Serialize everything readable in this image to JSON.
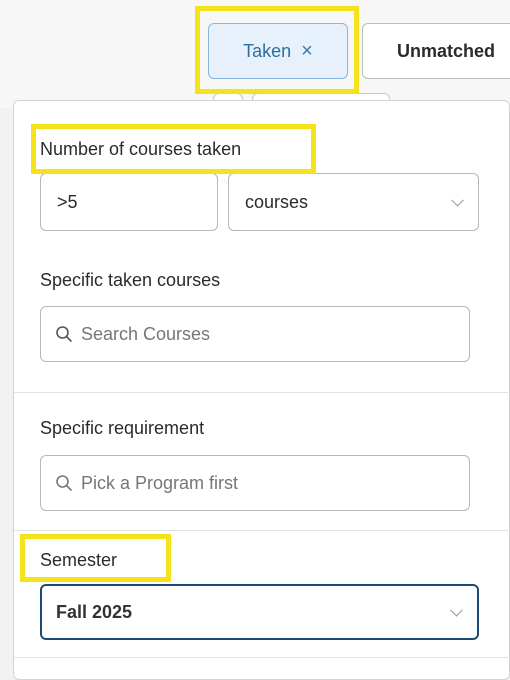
{
  "filters": {
    "taken_chip": {
      "label": "Taken",
      "remove_icon": "×"
    },
    "unmatched_chip": {
      "label": "Unmatched"
    }
  },
  "panel": {
    "number_of_courses": {
      "label": "Number of courses taken",
      "value": ">5",
      "unit": "courses"
    },
    "specific_courses": {
      "label": "Specific taken courses",
      "placeholder": "Search Courses"
    },
    "specific_requirement": {
      "label": "Specific requirement",
      "placeholder": "Pick a Program first"
    },
    "semester": {
      "label": "Semester",
      "value": "Fall 2025"
    }
  },
  "colors": {
    "highlight": "#f6e21b",
    "accent": "#2e6e9e",
    "focus_border": "#1e4a72"
  },
  "icons": {
    "remove": "close-icon",
    "search": "search-icon",
    "dropdown": "chevron-down-icon"
  }
}
